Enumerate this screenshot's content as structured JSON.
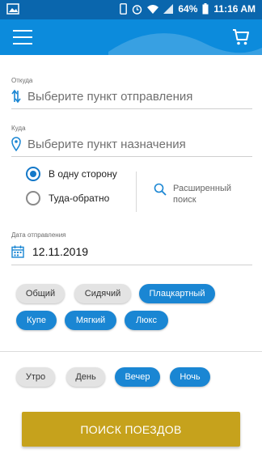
{
  "status_bar": {
    "battery": "64%",
    "time": "11:16 AM"
  },
  "app_bar": {
    "menu_icon": "hamburger-icon",
    "cart_icon": "cart-icon"
  },
  "from": {
    "label": "Откуда",
    "placeholder": "Выберите пункт отправления",
    "icon": "swap-vertical-icon"
  },
  "to": {
    "label": "Куда",
    "placeholder": "Выберите пункт назначения",
    "icon": "location-pin-icon"
  },
  "trip_type": {
    "options": [
      {
        "label": "В одну сторону",
        "selected": true
      },
      {
        "label": "Туда-обратно",
        "selected": false
      }
    ]
  },
  "advanced_search": {
    "label": "Расширенный поиск",
    "icon": "search-icon"
  },
  "date": {
    "label": "Дата отправления",
    "value": "12.11.2019",
    "icon": "calendar-icon"
  },
  "car_types": [
    {
      "label": "Общий",
      "selected": false
    },
    {
      "label": "Сидячий",
      "selected": false
    },
    {
      "label": "Плацкартный",
      "selected": true
    },
    {
      "label": "Купе",
      "selected": true
    },
    {
      "label": "Мягкий",
      "selected": true
    },
    {
      "label": "Люкс",
      "selected": true
    }
  ],
  "time_of_day": [
    {
      "label": "Утро",
      "selected": false
    },
    {
      "label": "День",
      "selected": false
    },
    {
      "label": "Вечер",
      "selected": true
    },
    {
      "label": "Ночь",
      "selected": true
    }
  ],
  "search_button": {
    "label": "ПОИСК ПОЕЗДОВ"
  },
  "colors": {
    "app_bar": "#0c8bdc",
    "status_bar": "#0a66ad",
    "accent": "#1a86d3",
    "search_button": "#c6a21c"
  }
}
